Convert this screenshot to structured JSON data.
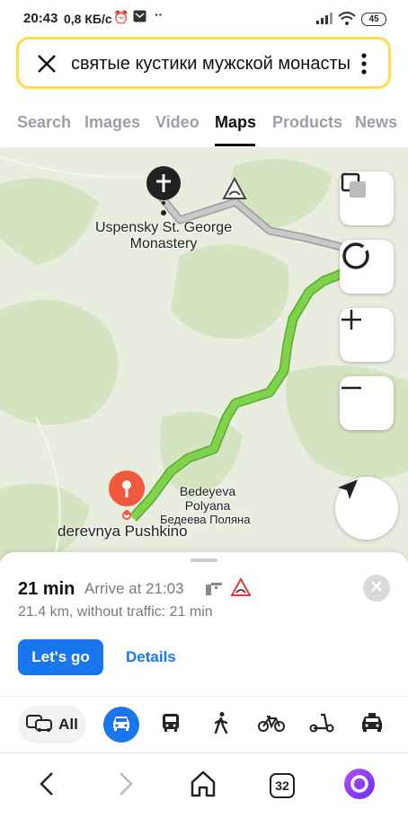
{
  "status_bar": {
    "time": "20:43",
    "network_speed": "0,8 КБ/с",
    "battery": "45",
    "icons": [
      "alarm-icon",
      "mail-icon",
      "more-dots-icon",
      "signal-icon",
      "wifi-icon",
      "battery-icon"
    ]
  },
  "search": {
    "query": "святые кустики мужской монастырь"
  },
  "tabs": [
    {
      "label": "Search"
    },
    {
      "label": "Images"
    },
    {
      "label": "Video"
    },
    {
      "label": "Maps"
    },
    {
      "label": "Products"
    },
    {
      "label": "News"
    }
  ],
  "active_tab": "Maps",
  "map": {
    "labels": {
      "monastery_line1": "Uspensky St. George",
      "monastery_line2": "Monastery",
      "village_en_line1": "Bedeyeva",
      "village_en_line2": "Polyana",
      "village_ru": "Бедеева Поляна",
      "destination": "derevnya Pushkino"
    },
    "colors": {
      "route": "#7ed34a",
      "route_outline": "#5aa832",
      "marker": "#ef5a3c",
      "forest": "#d4e3c0",
      "land": "#eaeee0"
    }
  },
  "route": {
    "duration": "21 min",
    "arrive": "Arrive at 21:03",
    "distance": "21.4 km, without traffic: 21 min",
    "go_label": "Let's go",
    "details_label": "Details"
  },
  "modes": {
    "all_label": "All",
    "items": [
      "car-icon",
      "bus-icon",
      "walk-icon",
      "bicycle-icon",
      "scooter-icon",
      "taxi-icon"
    ]
  },
  "browser_nav": {
    "tab_count": "32"
  },
  "colors": {
    "accent": "#1976ee",
    "search_border": "#ffdb4d",
    "alice": "#8a3ffc"
  }
}
